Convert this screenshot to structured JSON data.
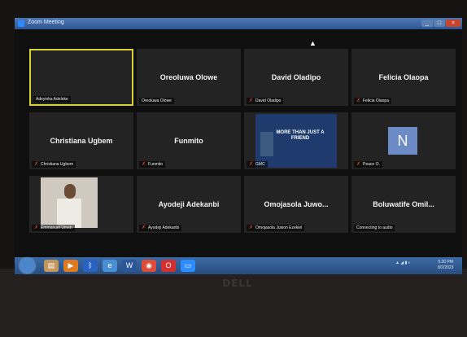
{
  "window": {
    "title": "Zoom Meeting",
    "min": "_",
    "max": "□",
    "close": "×"
  },
  "participants": [
    {
      "display": "",
      "label": "Adeyinka Adeleke",
      "muted": false,
      "speaking": true
    },
    {
      "display": "Oreoluwa Olowe",
      "label": "Oreoluwa Olowe",
      "muted": false
    },
    {
      "display": "David Oladipo",
      "label": "David Oladipo",
      "muted": true
    },
    {
      "display": "Felicia Olaopa",
      "label": "Felicia Olaopa",
      "muted": true
    },
    {
      "display": "Christiana Ugbem",
      "label": "Christiana Ugbem",
      "muted": true
    },
    {
      "display": "Funmito",
      "label": "Funmito",
      "muted": true
    },
    {
      "display": "",
      "label": "GMC",
      "muted": true,
      "poster_text": "MORE THAN JUST A FRIEND"
    },
    {
      "display": "N",
      "label": "Peace O.",
      "muted": true
    },
    {
      "display": "",
      "label": "Emmanuel Umeh",
      "muted": true
    },
    {
      "display": "Ayodeji Adekanbi",
      "label": "Ayodeji Adekanbi",
      "muted": true
    },
    {
      "display": "Omojasola Juwo...",
      "label": "Omojasola Juwon Ezekiel",
      "muted": true
    },
    {
      "display": "Boluwatife Omil...",
      "label": "Connecting to audio",
      "muted": false
    }
  ],
  "device": {
    "brand": "DELL"
  },
  "taskbar": {
    "icons": [
      "start-orb",
      "file-explorer",
      "media-player",
      "bluetooth",
      "internet-explorer",
      "word",
      "chrome",
      "opera",
      "zoom"
    ],
    "time": "5:20 PM",
    "date": "8/2/2023"
  },
  "colors": {
    "speaker_border": "#d8d139",
    "tile_bg": "#232323",
    "muted_icon": "#e0403a",
    "zoom_blue": "#2d8cff"
  }
}
